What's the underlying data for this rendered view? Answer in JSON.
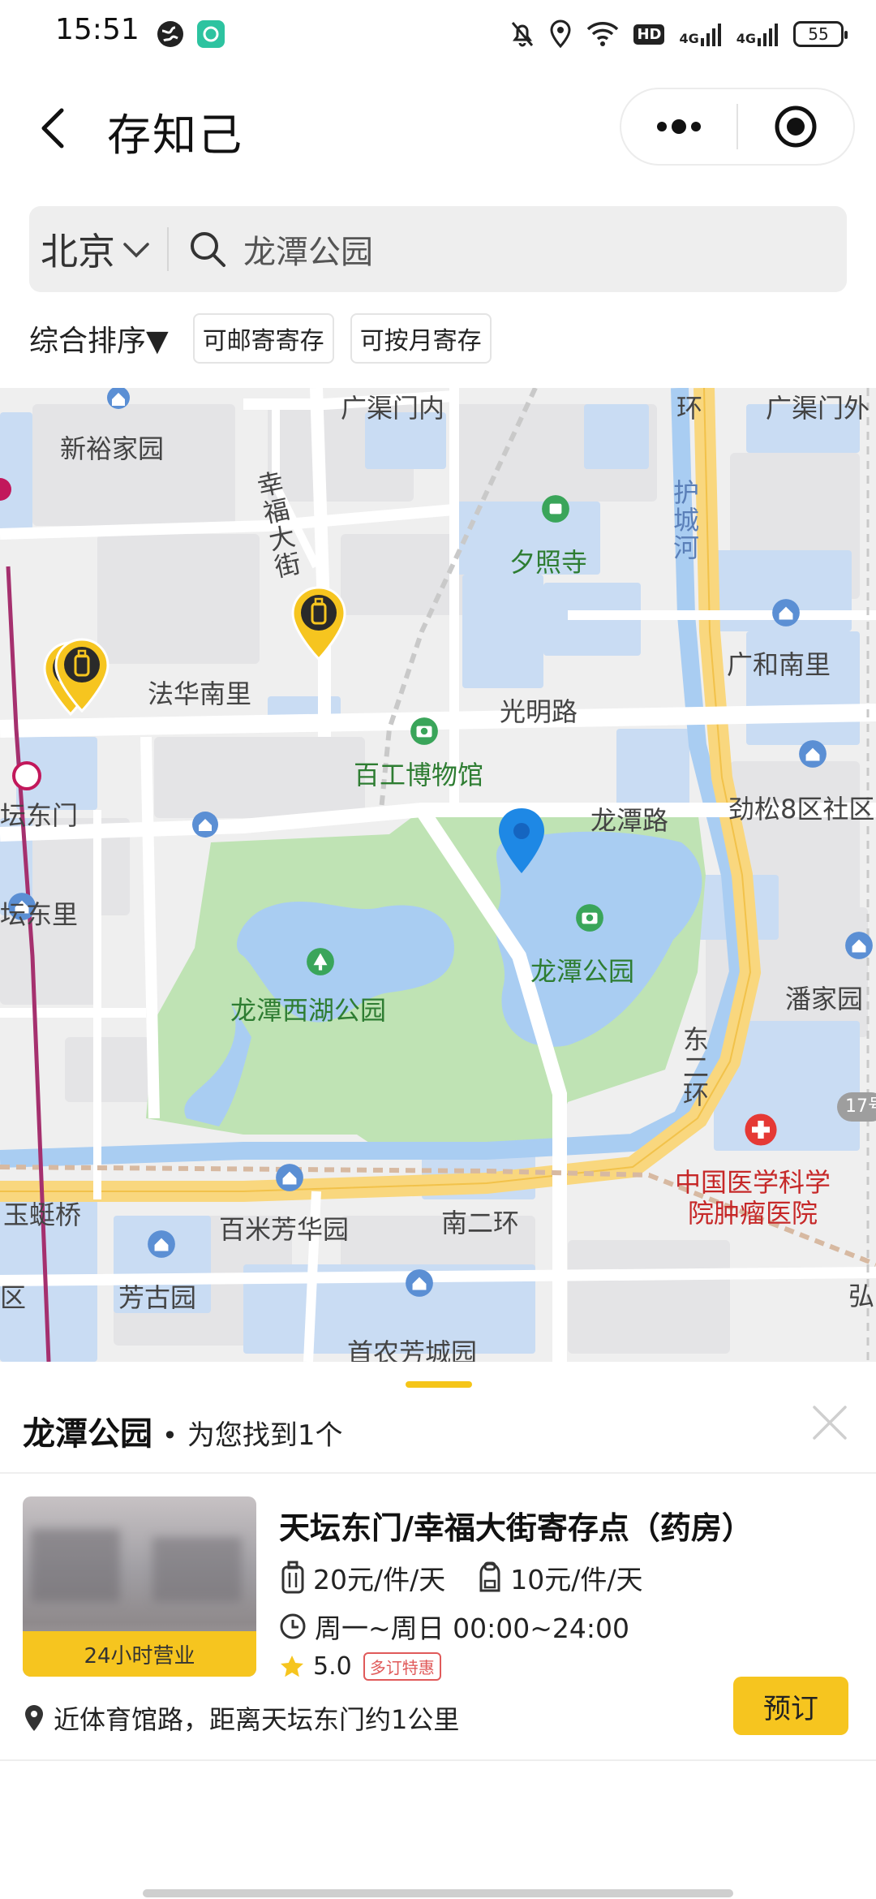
{
  "status": {
    "time": "15:51",
    "battery": "55",
    "network_1": "4G",
    "network_2": "4G",
    "hd": "HD"
  },
  "header": {
    "title": "存知己"
  },
  "search": {
    "city": "北京",
    "query": "龙潭公园"
  },
  "filters": {
    "sort": "综合排序▼",
    "chips": [
      "可邮寄寄存",
      "可按月寄存"
    ]
  },
  "map": {
    "labels": {
      "guangqumennei": "广渠门内",
      "guangqumenwai": "广渠门外",
      "huan_top": "环",
      "xinyujiayuan": "新裕家园",
      "xingfudajie": "幸福大街",
      "huchenghe": "护城河",
      "xizhaosi": "夕照寺",
      "guanghenanli": "广和南里",
      "fahuananli": "法华南里",
      "guangminglu": "光明路",
      "baigongbowuguan": "百工博物馆",
      "tandongmen": "坛东门",
      "longtanlu": "龙潭路",
      "jinsong": "劲松8区社区",
      "longtangongyuan": "龙潭公园",
      "tandongli": "坛东里",
      "panjiayuan": "潘家园",
      "longtanxihu": "龙潭西湖公园",
      "dongerhuan": "东二环",
      "road_17": "17号",
      "zhongguoyixue_1": "中国医学科学",
      "zhongguoyixue_2": "院肿瘤医院",
      "yudiqiao": "玉蜓桥",
      "baimifanghuayuan": "百米芳华园",
      "nanerhuan": "南二环",
      "fangguyuan": "芳古园",
      "shounongfangcheng": "首农芳城园",
      "qu": "区",
      "hong": "弘"
    }
  },
  "sheet": {
    "place": "龙潭公园",
    "dot": "•",
    "found": "为您找到1个",
    "card": {
      "badge": "24小时营业",
      "name": "天坛东门/幸福大街寄存点（药房）",
      "price_large": "20元/件/天",
      "price_small": "10元/件/天",
      "hours": "周一~周日 00:00~24:00",
      "rating": "5.0",
      "promo": "多订特惠",
      "address": "近体育馆路，距离天坛东门约1公里",
      "book": "预订"
    }
  },
  "colors": {
    "accent": "#f6c51f",
    "water": "#a9cdf2",
    "park": "#bfe3b4",
    "road_major": "#f9d77e",
    "pin_blue": "#1e88e5"
  }
}
